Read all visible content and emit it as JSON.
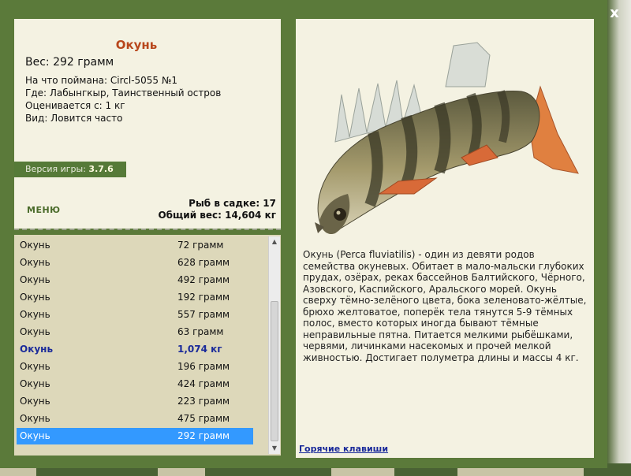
{
  "window": {
    "close_label": "x"
  },
  "fish": {
    "name": "Окунь",
    "weight": "Вес: 292 грамм",
    "caught_on": "На что поймана: Circl-5055 №1",
    "location": "Где: Лабынгкыр, Таинственный остров",
    "valued_from": "Оценивается с: 1 кг",
    "frequency": "Вид: Ловится часто"
  },
  "version": {
    "label": "Версия игры:",
    "value": "3.7.6"
  },
  "menu": {
    "label": "МЕНЮ"
  },
  "stats": {
    "fish_count": "Рыб в садке: 17",
    "total_weight": "Общий вес: 14,604 кг"
  },
  "catch_list": [
    {
      "name": "Окунь",
      "weight": "72 грамм"
    },
    {
      "name": "Окунь",
      "weight": "628 грамм"
    },
    {
      "name": "Окунь",
      "weight": "492 грамм"
    },
    {
      "name": "Окунь",
      "weight": "192 грамм"
    },
    {
      "name": "Окунь",
      "weight": "557 грамм"
    },
    {
      "name": "Окунь",
      "weight": "63 грамм"
    },
    {
      "name": "Окунь",
      "weight": "1,074 кг",
      "highlighted": true
    },
    {
      "name": "Окунь",
      "weight": "196 грамм"
    },
    {
      "name": "Окунь",
      "weight": "424 грамм"
    },
    {
      "name": "Окунь",
      "weight": "223 грамм"
    },
    {
      "name": "Окунь",
      "weight": "475 грамм"
    },
    {
      "name": "Окунь",
      "weight": "292 грамм",
      "selected": true
    }
  ],
  "description": "Окунь (Perca fluviatilis) - один из девяти родов семейства окуневых. Обитает в мало-мальски глубоких прудах, озёрах, реках бассейнов Балтийского, Чёрного, Азовского, Каспийского, Аральского морей. Окунь сверху тёмно-зелёного цвета, бока зеленовато-жёлтые, брюхо желтоватое, поперёк тела тянутся 5-9 тёмных полос, вместо которых иногда бывают тёмные неправильные пятна. Питается мелкими рыбёшками, червями, личинками насекомых и прочей мелкой живностью. Достигает полуметра длины и массы 4 кг.",
  "hotkeys": {
    "label": "Горячие клавиши"
  },
  "colors": {
    "frame": "#5b7a3a",
    "panel": "#f4f2e2",
    "list_bg": "#ddd8ba",
    "title": "#b8471c",
    "selected": "#3399ff",
    "link": "#1a2a9a"
  }
}
